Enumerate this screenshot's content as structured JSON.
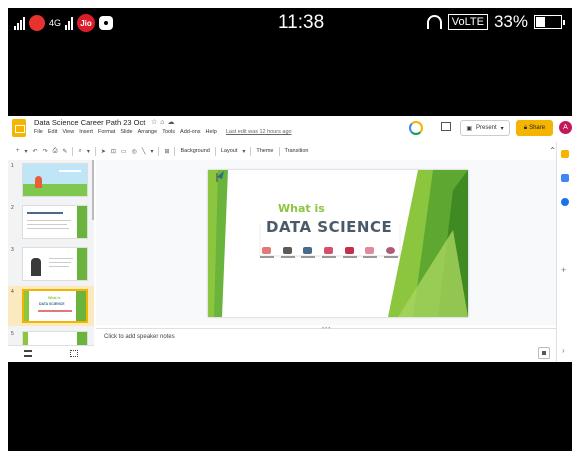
{
  "statusbar": {
    "time": "11:38",
    "network": "4G",
    "carrier": "Jio",
    "volte": "VoLTE",
    "battery_percent": "33%",
    "battery_level": 0.33
  },
  "app": {
    "doc_title": "Data Science Career Path 23 Oct",
    "menu": [
      "File",
      "Edit",
      "View",
      "Insert",
      "Format",
      "Slide",
      "Arrange",
      "Tools",
      "Add-ons",
      "Help"
    ],
    "last_edit": "Last edit was 12 hours ago",
    "present_label": "Present",
    "share_label": "Share",
    "user_initial": "A",
    "toolbar": {
      "background": "Background",
      "layout": "Layout",
      "theme": "Theme",
      "transition": "Transition"
    },
    "slides": [
      {
        "num": "1"
      },
      {
        "num": "2"
      },
      {
        "num": "3"
      },
      {
        "num": "4"
      },
      {
        "num": "5"
      }
    ],
    "selected_slide": 4,
    "slide": {
      "subtitle": "What is",
      "title": "DATA SCIENCE"
    },
    "notes_placeholder": "Click to add speaker notes"
  },
  "colors": {
    "accent_green": "#8cc63f",
    "dark_green": "#4e9a2a",
    "share_yellow": "#f4b400",
    "avatar": "#c2185b"
  }
}
